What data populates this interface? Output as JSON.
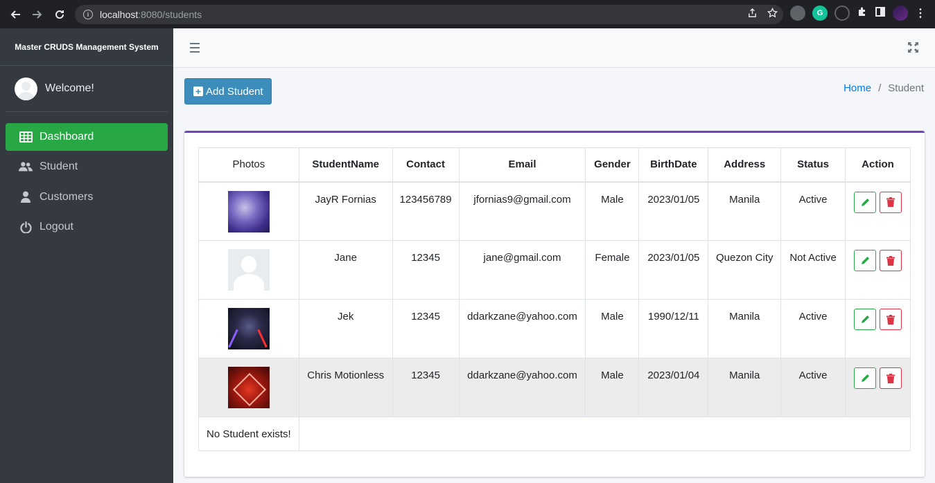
{
  "browser": {
    "url_host": "localhost",
    "url_rest": ":8080/students"
  },
  "sidebar": {
    "brand": "Master CRUDS Management System",
    "welcome": "Welcome!",
    "items": [
      {
        "label": "Dashboard",
        "icon": "table-grid-icon",
        "active": true
      },
      {
        "label": "Student",
        "icon": "users-icon",
        "active": false
      },
      {
        "label": "Customers",
        "icon": "user-icon",
        "active": false
      },
      {
        "label": "Logout",
        "icon": "power-icon",
        "active": false
      }
    ]
  },
  "toolbar": {
    "add_label": "Add Student"
  },
  "breadcrumb": {
    "home": "Home",
    "separator": "/",
    "current": "Student"
  },
  "table": {
    "headers": [
      "Photos",
      "StudentName",
      "Contact",
      "Email",
      "Gender",
      "BirthDate",
      "Address",
      "Status",
      "Action"
    ],
    "rows": [
      {
        "name": "JayR Fornias",
        "contact": "123456789",
        "email": "jfornias9@gmail.com",
        "gender": "Male",
        "birthdate": "2023/01/05",
        "address": "Manila",
        "status": "Active"
      },
      {
        "name": "Jane",
        "contact": "12345",
        "email": "jane@gmail.com",
        "gender": "Female",
        "birthdate": "2023/01/05",
        "address": "Quezon City",
        "status": "Not Active"
      },
      {
        "name": "Jek",
        "contact": "12345",
        "email": "ddarkzane@yahoo.com",
        "gender": "Male",
        "birthdate": "1990/12/11",
        "address": "Manila",
        "status": "Active"
      },
      {
        "name": "Chris Motionless",
        "contact": "12345",
        "email": "ddarkzane@yahoo.com",
        "gender": "Male",
        "birthdate": "2023/01/04",
        "address": "Manila",
        "status": "Active"
      }
    ],
    "empty_message": "No Student exists!"
  },
  "colors": {
    "sidebar_bg": "#343a40",
    "active_green": "#28a745",
    "add_button": "#3c8dbc",
    "card_top_border": "#6f42c1",
    "delete_red": "#dc3545"
  }
}
